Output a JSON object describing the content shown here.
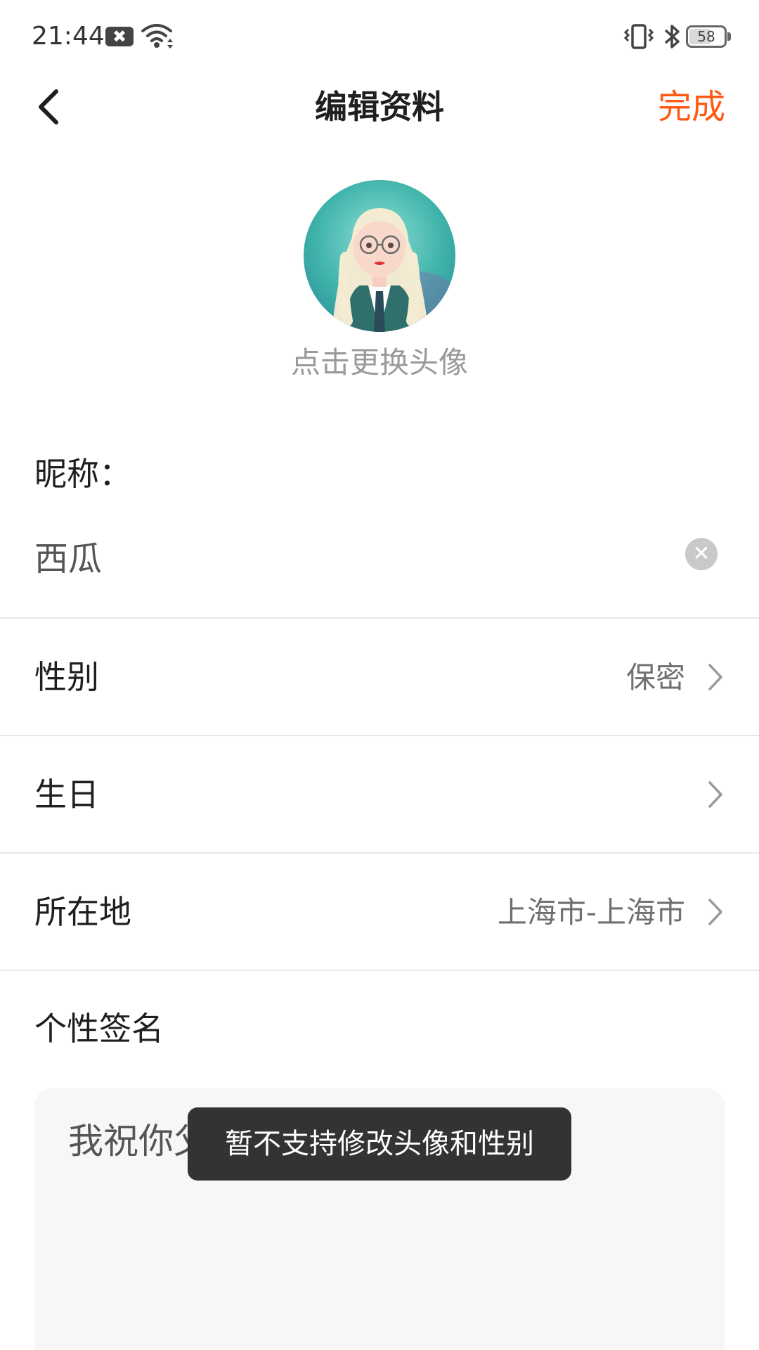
{
  "status_bar": {
    "time": "21:44",
    "notification_glyph": "✖",
    "battery_level": "58",
    "icons": [
      "notification-icon",
      "wifi-icon",
      "vibrate-icon",
      "bluetooth-icon",
      "battery-icon"
    ]
  },
  "header": {
    "title": "编辑资料",
    "done_label": "完成",
    "back_icon": "chevron-left-icon"
  },
  "avatar": {
    "hint": "点击更换头像"
  },
  "nickname": {
    "label": "昵称：",
    "value": "西瓜",
    "clear_glyph": "✕"
  },
  "rows": [
    {
      "label": "性别",
      "value": "保密"
    },
    {
      "label": "生日",
      "value": ""
    },
    {
      "label": "所在地",
      "value": "上海市-上海市"
    }
  ],
  "signature": {
    "label": "个性签名",
    "text": "我祝你父母长命百岁"
  },
  "toast": {
    "text": "暂不支持修改头像和性别"
  },
  "colors": {
    "accent": "#ff5a14",
    "toast_bg": "#333333",
    "divider": "#e8e8e8",
    "secondary_text": "#9a9a9a"
  }
}
